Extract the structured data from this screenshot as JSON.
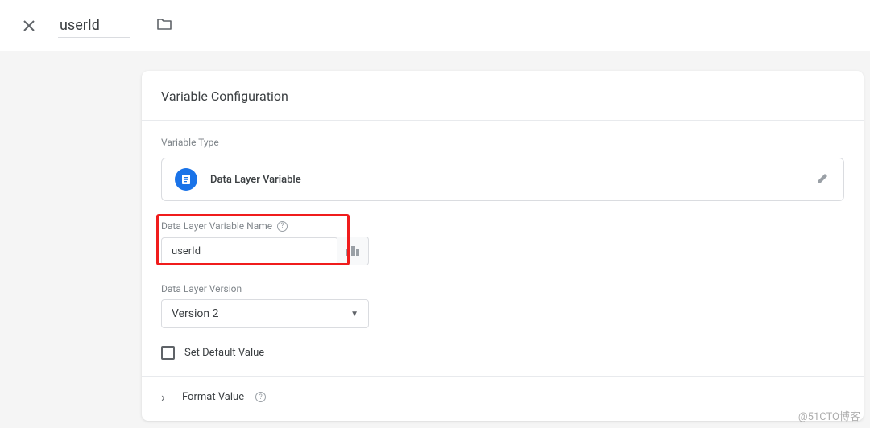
{
  "header": {
    "title_value": "userId"
  },
  "card": {
    "title": "Variable Configuration",
    "type_section": {
      "label": "Variable Type",
      "name": "Data Layer Variable"
    },
    "name_field": {
      "label": "Data Layer Variable Name",
      "value": "userId"
    },
    "version_field": {
      "label": "Data Layer Version",
      "value": "Version 2"
    },
    "default_checkbox": {
      "label": "Set Default Value"
    },
    "format_section": {
      "label": "Format Value"
    }
  },
  "watermark": "@51CTO博客"
}
